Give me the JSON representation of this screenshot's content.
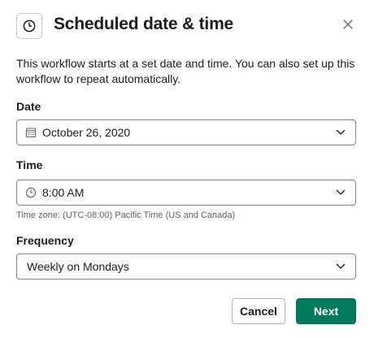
{
  "dialog": {
    "title": "Scheduled date & time",
    "description": "This workflow starts at a set date and time. You can also set up this workflow to repeat automatically."
  },
  "date": {
    "label": "Date",
    "value": "October 26, 2020",
    "icon": "calendar-icon"
  },
  "time": {
    "label": "Time",
    "value": "8:00 AM",
    "icon": "clock-icon",
    "timezone_hint": "Time zone: (UTC-08:00) Pacific Time (US and Canada)"
  },
  "frequency": {
    "label": "Frequency",
    "value": "Weekly on Mondays"
  },
  "buttons": {
    "cancel_label": "Cancel",
    "next_label": "Next"
  },
  "colors": {
    "primary": "#007a5a",
    "text": "#1d1c1d",
    "muted": "#616061"
  }
}
